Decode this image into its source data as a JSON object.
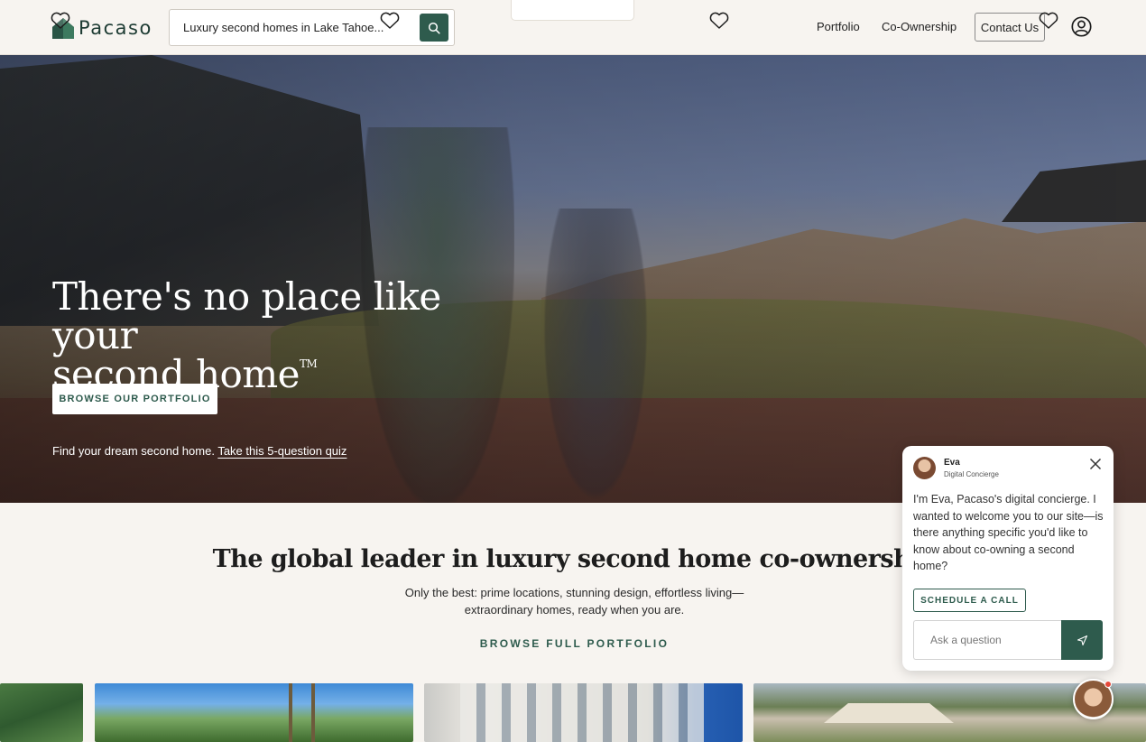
{
  "brand": {
    "name": "Pacaso"
  },
  "search": {
    "placeholder": "Luxury second homes in Lake Tahoe..."
  },
  "nav": {
    "portfolio": "Portfolio",
    "co_ownership": "Co-Ownership",
    "contact": "Contact Us"
  },
  "hero": {
    "title_line1": "There's no place like your",
    "title_line2": "second home",
    "trademark": "TM",
    "cta": "BROWSE OUR PORTFOLIO",
    "quiz_prefix": "Find your dream second home.",
    "quiz_link": "Take this 5-question quiz"
  },
  "section": {
    "title": "The global leader in luxury second home co-ownership",
    "subtitle_line1": "Only the best: prime locations, stunning design, effortless living—",
    "subtitle_line2": "extraordinary homes, ready when you are.",
    "link": "BROWSE FULL PORTFOLIO"
  },
  "chat": {
    "agent_name": "Eva",
    "agent_role": "Digital Concierge",
    "message": "I'm Eva, Pacaso's digital concierge. I wanted to welcome you to our site—is there anything specific you'd like to know about co-owning a second home?",
    "schedule_label": "SCHEDULE A CALL",
    "input_placeholder": "Ask a question"
  },
  "colors": {
    "brand_green": "#2e5b4d",
    "background": "#f7f4f0",
    "notification": "#e5493a"
  },
  "icons": [
    "logo-house-icon",
    "search-icon",
    "account-icon",
    "heart-icon",
    "close-icon",
    "send-icon"
  ]
}
